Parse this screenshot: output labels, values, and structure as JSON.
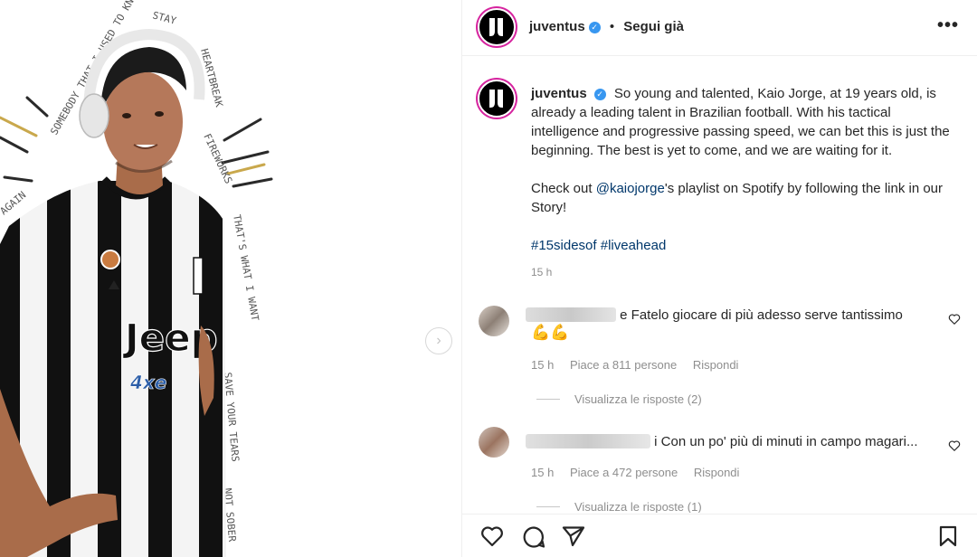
{
  "post": {
    "account": "juventus",
    "follow_status": "Segui già",
    "more_label": "•••",
    "caption_p1": "So young and talented, Kaio Jorge, at 19 years old, is already a leading talent in Brazilian football. With his tactical intelligence and progressive passing speed, we can bet this is just the beginning. The best is yet to come, and we are waiting for it.",
    "caption_p2_prefix": "Check out ",
    "caption_mention": "@kaiojorge",
    "caption_p2_suffix": "'s playlist on Spotify by following the link in our Story!",
    "hashtag1": "#15sidesof",
    "hashtag2": "#liveahead",
    "time": "15 h"
  },
  "media": {
    "jersey_sponsor": "Jeep",
    "jersey_sub": "4xe",
    "lyrics_text": "AGAIN · SOMEBODY THAT I USED TO KNOW · STAY · HEARTBREAK · FIREWORKS · THAT'S WHAT I WANT · SAVE YOUR TEARS · NOT SOBER"
  },
  "comments": [
    {
      "text": "e Fatelo giocare di più adesso serve tantissimo",
      "emoji": "💪💪",
      "time": "15 h",
      "likes": "Piace a 811 persone",
      "reply": "Rispondi",
      "view_replies": "Visualizza le risposte (2)"
    },
    {
      "text": "i Con un po' più di minuti in campo magari...",
      "time": "15 h",
      "likes": "Piace a 472 persone",
      "reply": "Rispondi",
      "view_replies": "Visualizza le risposte (1)"
    }
  ],
  "colors": {
    "verified": "#3897f0",
    "link": "#00376b",
    "story_ring": "#d6249f",
    "muted": "#8e8e8e"
  },
  "icons": [
    "juventus-logo-icon",
    "verified-icon",
    "more-options-icon",
    "heart-icon",
    "comment-icon",
    "share-icon",
    "bookmark-icon",
    "chevron-right-icon"
  ]
}
